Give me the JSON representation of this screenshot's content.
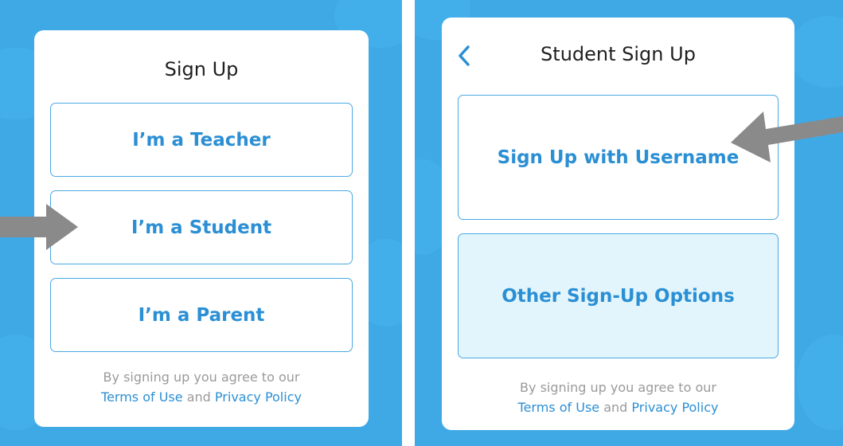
{
  "student_role_screen": {
    "title": "Sign Up",
    "options": [
      {
        "label": "I’m a Teacher"
      },
      {
        "label": "I’m a Student"
      },
      {
        "label": "I’m a Parent"
      }
    ],
    "legal": {
      "prefix": "By signing up you agree to our",
      "terms_label": "Terms of Use",
      "conjunction": "and",
      "privacy_label": "Privacy Policy"
    }
  },
  "student_signup_screen": {
    "back_icon": "chevron-left-icon",
    "title": "Student Sign Up",
    "options": [
      {
        "label": "Sign Up with Username"
      },
      {
        "label": "Other Sign-Up Options"
      }
    ],
    "legal": {
      "prefix": "By signing up you agree to our",
      "terms_label": "Terms of Use",
      "conjunction": "and",
      "privacy_label": "Privacy Policy"
    }
  },
  "colors": {
    "background": "#3fa9e6",
    "accent": "#2b8fd4",
    "border": "#4aa9e3",
    "highlight_fill": "#e2f5fc",
    "arrow": "#8a8a8a"
  },
  "annotations": {
    "arrow_icon": "pointer-arrow-icon"
  }
}
